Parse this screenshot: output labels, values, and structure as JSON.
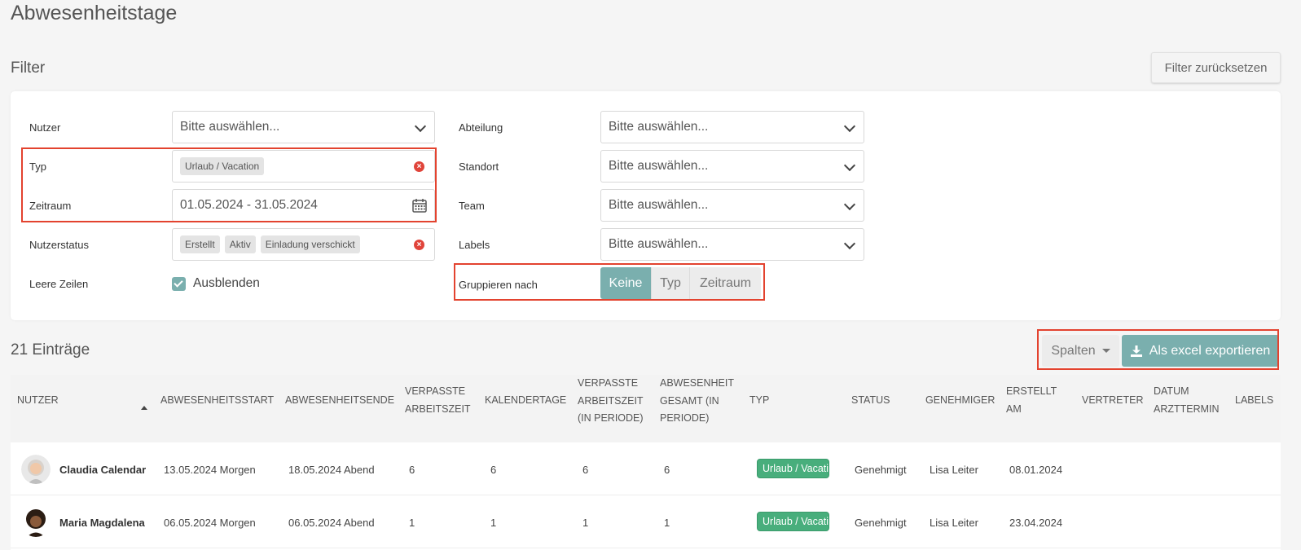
{
  "page_title": "Abwesenheitstage",
  "filter": {
    "title": "Filter",
    "reset_label": "Filter zurücksetzen",
    "left": {
      "nutzer_label": "Nutzer",
      "nutzer_value": "Bitte auswählen...",
      "typ_label": "Typ",
      "typ_tags": [
        "Urlaub / Vacation"
      ],
      "zeitraum_label": "Zeitraum",
      "zeitraum_value": "01.05.2024 - 31.05.2024",
      "nutzerstatus_label": "Nutzerstatus",
      "nutzerstatus_tags": [
        "Erstellt",
        "Aktiv",
        "Einladung verschickt"
      ],
      "leere_zeilen_label": "Leere Zeilen",
      "leere_zeilen_option": "Ausblenden"
    },
    "right": {
      "abteilung_label": "Abteilung",
      "abteilung_value": "Bitte auswählen...",
      "standort_label": "Standort",
      "standort_value": "Bitte auswählen...",
      "team_label": "Team",
      "team_value": "Bitte auswählen...",
      "labels_label": "Labels",
      "labels_value": "Bitte auswählen...",
      "gruppieren_label": "Gruppieren nach",
      "gruppieren_options": [
        "Keine",
        "Typ",
        "Zeitraum"
      ]
    }
  },
  "results": {
    "count_label": "21 Einträge",
    "columns_button": "Spalten",
    "export_button": "Als excel exportieren"
  },
  "table": {
    "headers": {
      "nutzer": "Nutzer",
      "start": "Abwesenheitsstart",
      "ende": "Abwesenheitsende",
      "verpasste_1": "Verpasste",
      "verpasste_2": "Arbeitszeit",
      "kalendertage": "Kalendertage",
      "vp_1": "Verpasste",
      "vp_2": "Arbeitszeit",
      "vp_3": "(in Periode)",
      "ag_1": "Abwesenheit",
      "ag_2": "gesamt (in",
      "ag_3": "Periode)",
      "typ": "Typ",
      "status": "Status",
      "genehmiger": "Genehmiger",
      "erstellt_1": "Erstellt",
      "erstellt_2": "am",
      "vertreter": "Vertreter",
      "datum_1": "Datum",
      "datum_2": "Arzttermin",
      "labels": "Labels"
    },
    "rows": [
      {
        "nutzer": "Claudia Calendar",
        "start": "13.05.2024 Morgen",
        "ende": "18.05.2024 Abend",
        "verpasste": "6",
        "kalendertage": "6",
        "verpasste_periode": "6",
        "gesamt_periode": "6",
        "typ": "Urlaub / Vacation",
        "status": "Genehmigt",
        "genehmiger": "Lisa Leiter",
        "erstellt": "08.01.2024"
      },
      {
        "nutzer": "Maria Magdalena",
        "start": "06.05.2024 Morgen",
        "ende": "06.05.2024 Abend",
        "verpasste": "1",
        "kalendertage": "1",
        "verpasste_periode": "1",
        "gesamt_periode": "1",
        "typ": "Urlaub / Vacation",
        "status": "Genehmigt",
        "genehmiger": "Lisa Leiter",
        "erstellt": "23.04.2024"
      }
    ]
  },
  "colors": {
    "accent": "#7aafae",
    "badge_green": "#48ae7c",
    "highlight": "#e3432f"
  }
}
